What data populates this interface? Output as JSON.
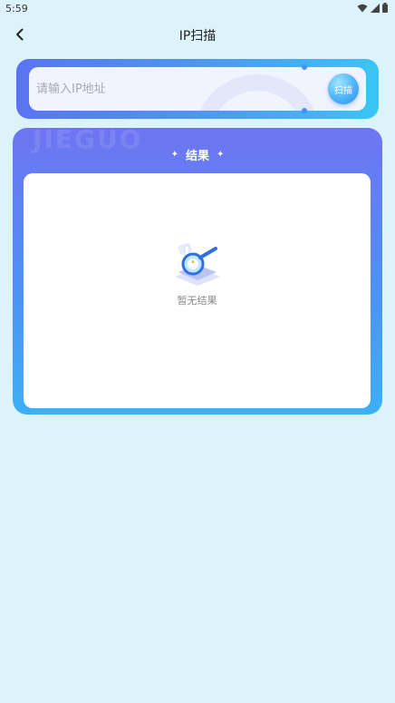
{
  "status_bar": {
    "time": "5:59"
  },
  "nav": {
    "title": "IP扫描"
  },
  "search": {
    "placeholder": "请输入IP地址",
    "value": "",
    "button_label": "扫描"
  },
  "results": {
    "watermark": "JIEGUO",
    "title": "结果",
    "empty_text": "暂无结果"
  },
  "colors": {
    "background": "#dcf3fb",
    "card_gradient_start": "#5a73f3",
    "card_gradient_end": "#39c6f5"
  }
}
